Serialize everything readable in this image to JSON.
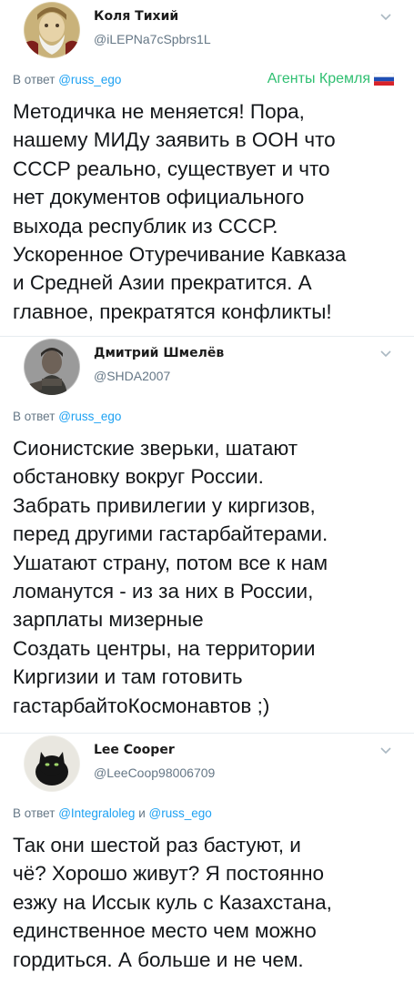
{
  "tweets": [
    {
      "name": "Коля Тихий",
      "handle": "@iLEPNa7cSpbrs1L",
      "reply_prefix": "В ответ",
      "reply_mentions": [
        "@russ_ego"
      ],
      "reply_joiner": "",
      "tag": "Агенты Кремля",
      "text": "Методичка не меняется! Пора,\nнашему МИДу заявить в ООН что\nСССР реально, существует и что\nнет документов официального\nвыхода республик из СССР.\nУскоренное Отуречивание Кавказа\nи Средней Азии прекратится. А\nглавное, прекратятся конфликты!"
    },
    {
      "name": "Дмитрий Шмелёв",
      "handle": "@SHDA2007",
      "reply_prefix": "В ответ",
      "reply_mentions": [
        "@russ_ego"
      ],
      "reply_joiner": "",
      "text": "Сионистские зверьки, шатают\nобстановку вокруг России.\nЗабрать привилегии у киргизов,\nперед другими гастарбайтерами.\nУшатают страну, потом все к нам\nломанутся - из за них в России,\nзарплаты мизерные\nСоздать центры, на территории\nКиргизии и там готовить\nгастарбайтоКосмонавтов ;)"
    },
    {
      "name": "Lee Cooper",
      "handle": "@LeeCoop98006709",
      "reply_prefix": "В ответ",
      "reply_mentions": [
        "@Integraloleg",
        "@russ_ego"
      ],
      "reply_joiner": "и",
      "text": "Так они шестой раз бастуют, и\nчё? Хорошо живут? Я постоянно\nезжу на Иссык куль с Казахстана,\nединственное место чем можно\nгордиться. А больше и не чем."
    }
  ],
  "colors": {
    "link": "#1da1f2",
    "muted": "#657786",
    "tag_green": "#2fbf71",
    "text": "#14171a"
  },
  "icons": {
    "chevron": "chevron-down-icon",
    "flag": "russian-flag-icon"
  }
}
